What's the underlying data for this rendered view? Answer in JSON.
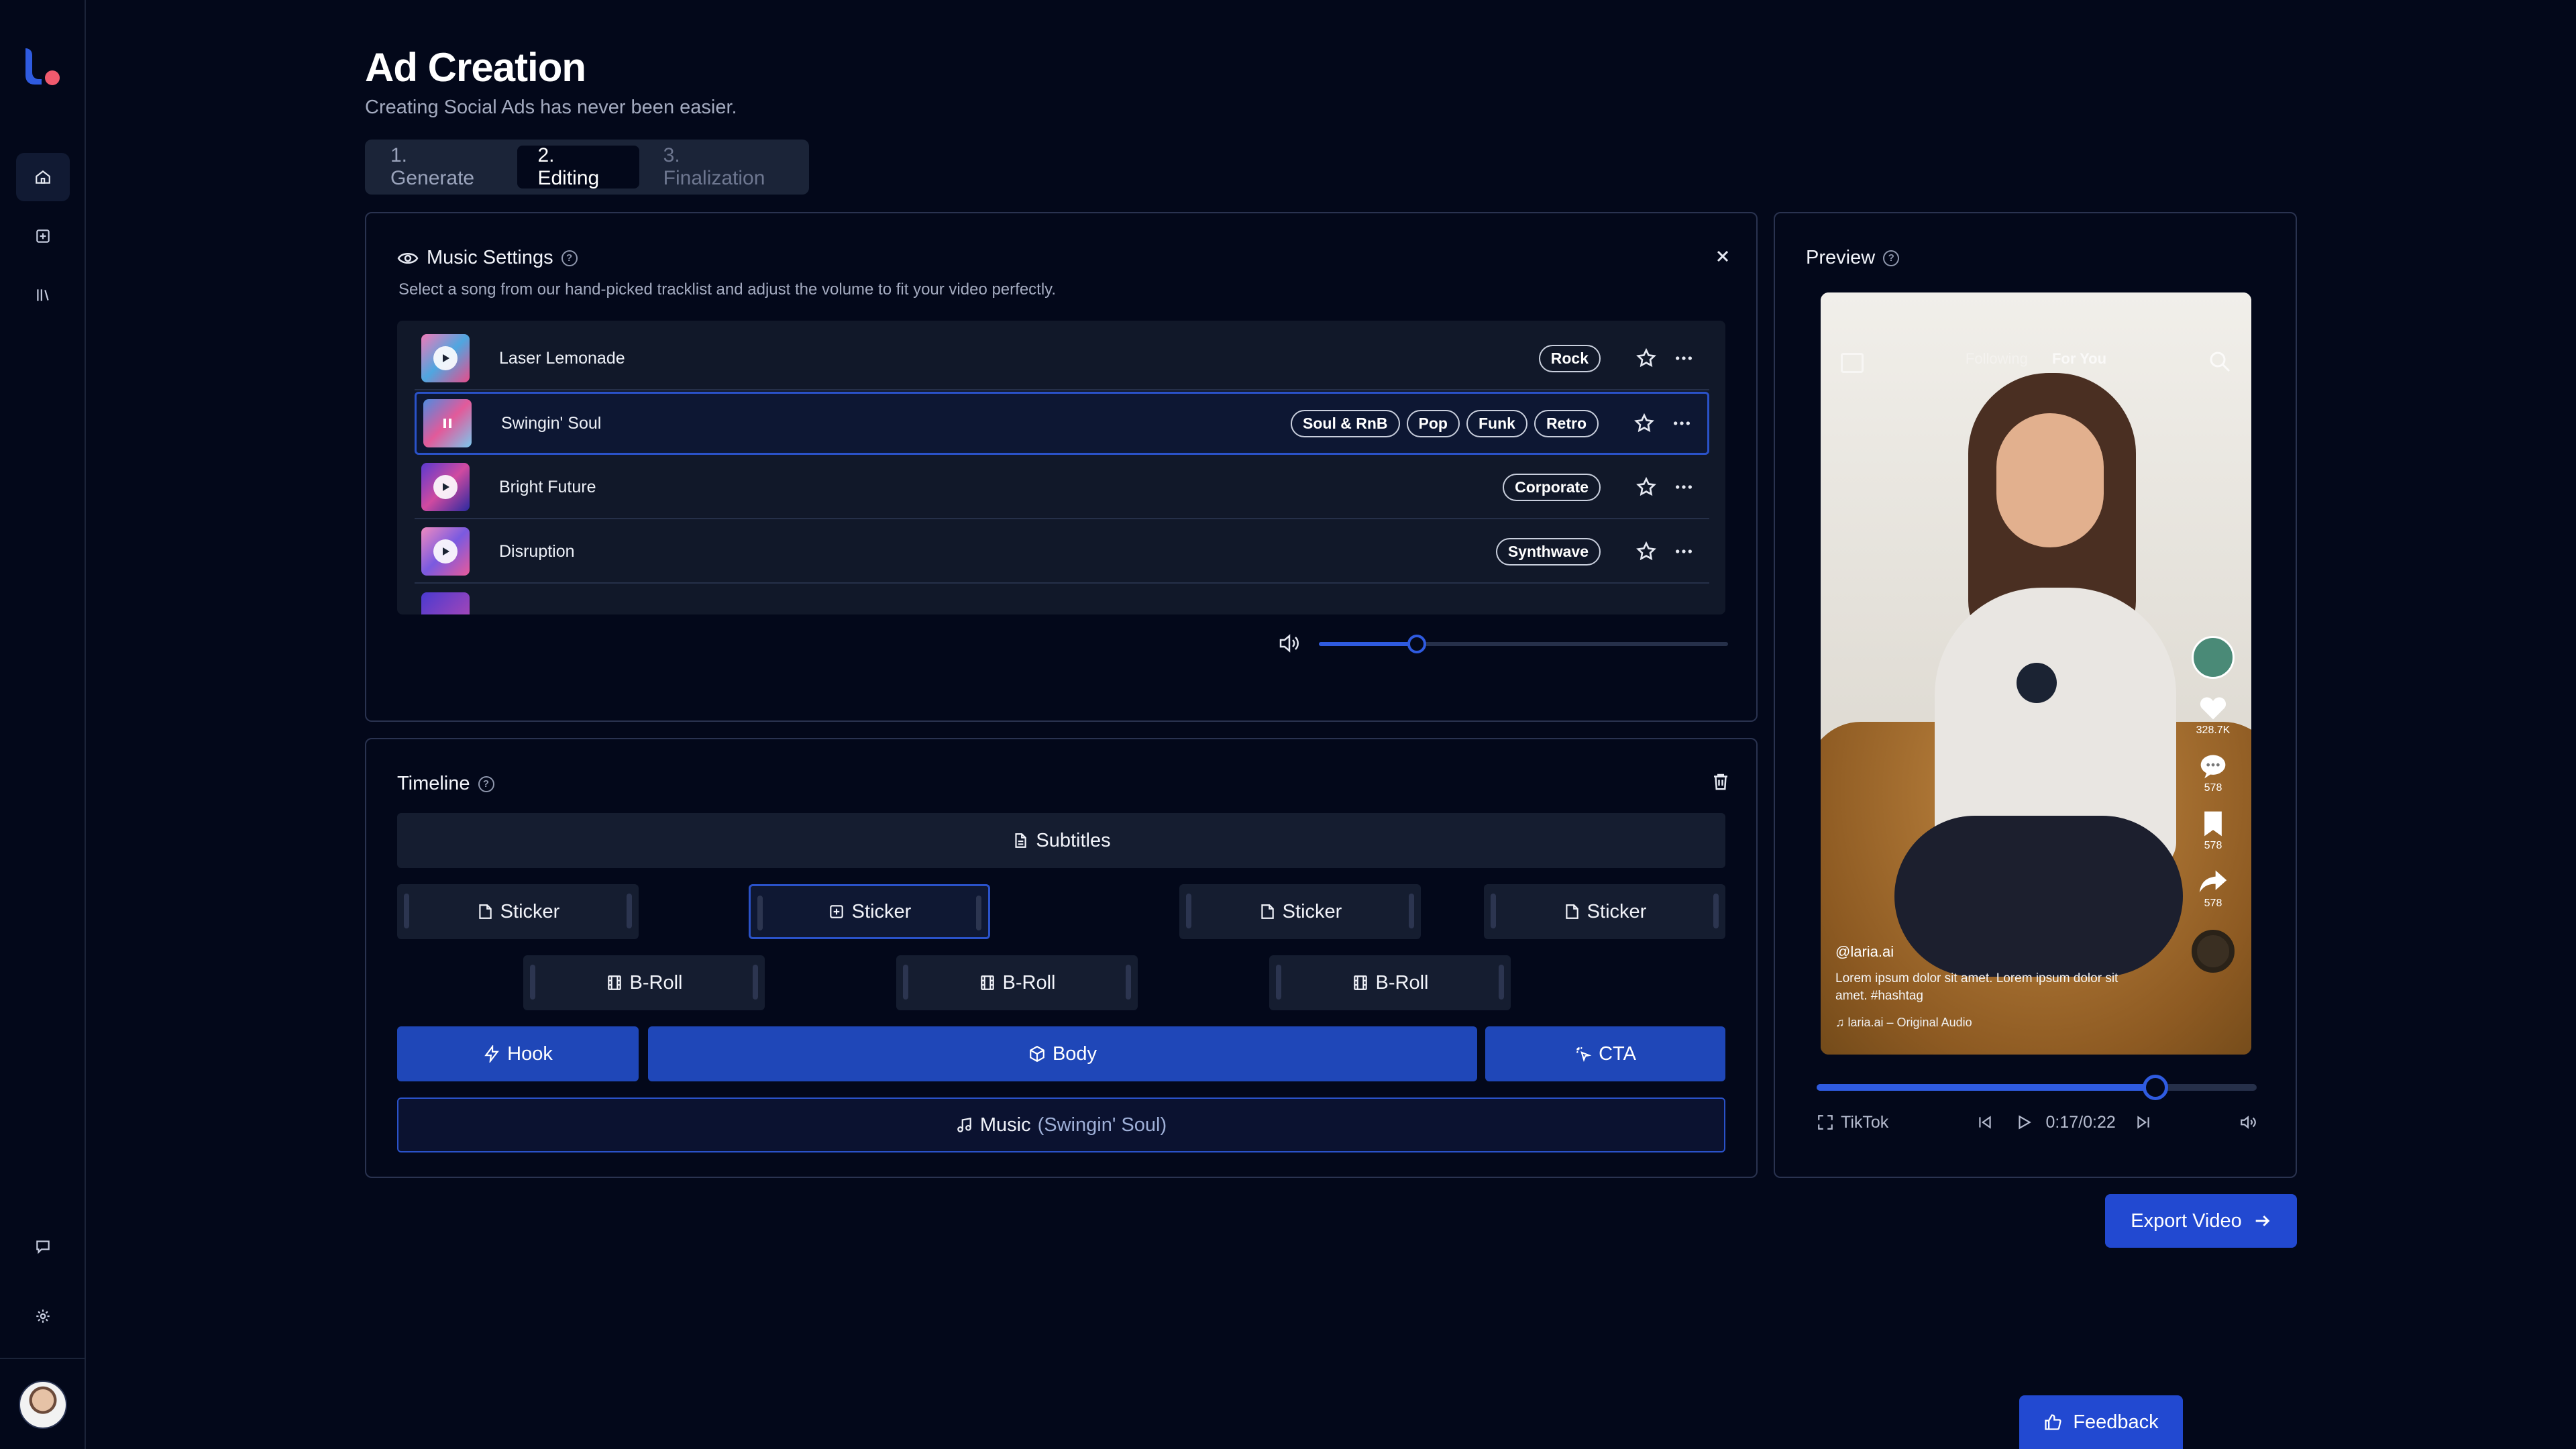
{
  "header": {
    "title": "Ad Creation",
    "subtitle": "Creating Social Ads has never been easier."
  },
  "steps": [
    "1. Generate",
    "2. Editing",
    "3. Finalization"
  ],
  "music": {
    "title": "Music Settings",
    "description": "Select a song from our hand-picked tracklist and adjust the volume to fit your video perfectly.",
    "volume_percent": 24,
    "tracks": [
      {
        "name": "Laser Lemonade",
        "tags": [
          "Rock"
        ],
        "playing": false
      },
      {
        "name": "Swingin' Soul",
        "tags": [
          "Soul & RnB",
          "Pop",
          "Funk",
          "Retro"
        ],
        "playing": true
      },
      {
        "name": "Bright Future",
        "tags": [
          "Corporate"
        ],
        "playing": false
      },
      {
        "name": "Disruption",
        "tags": [
          "Synthwave"
        ],
        "playing": false
      }
    ]
  },
  "timeline": {
    "title": "Timeline",
    "subtitles_label": "Subtitles",
    "sticker_label": "Sticker",
    "broll_label": "B-Roll",
    "hook_label": "Hook",
    "body_label": "Body",
    "cta_label": "CTA",
    "music_label": "Music",
    "music_song": "(Swingin' Soul)"
  },
  "preview": {
    "title": "Preview",
    "tab_following": "Following",
    "tab_for_you": "For You",
    "likes": "328.7K",
    "comments": "578",
    "saves": "578",
    "shares": "578",
    "handle": "@laria.ai",
    "caption": "Lorem ipsum dolor sit amet. Lorem ipsum dolor sit amet. #hashtag",
    "audio": "laria.ai – Original Audio",
    "platform": "TikTok",
    "time": "0:17/0:22",
    "progress": 0.77
  },
  "buttons": {
    "export": "Export Video",
    "feedback": "Feedback"
  },
  "colors": {
    "accent": "#2249d1",
    "background": "#03081a"
  }
}
